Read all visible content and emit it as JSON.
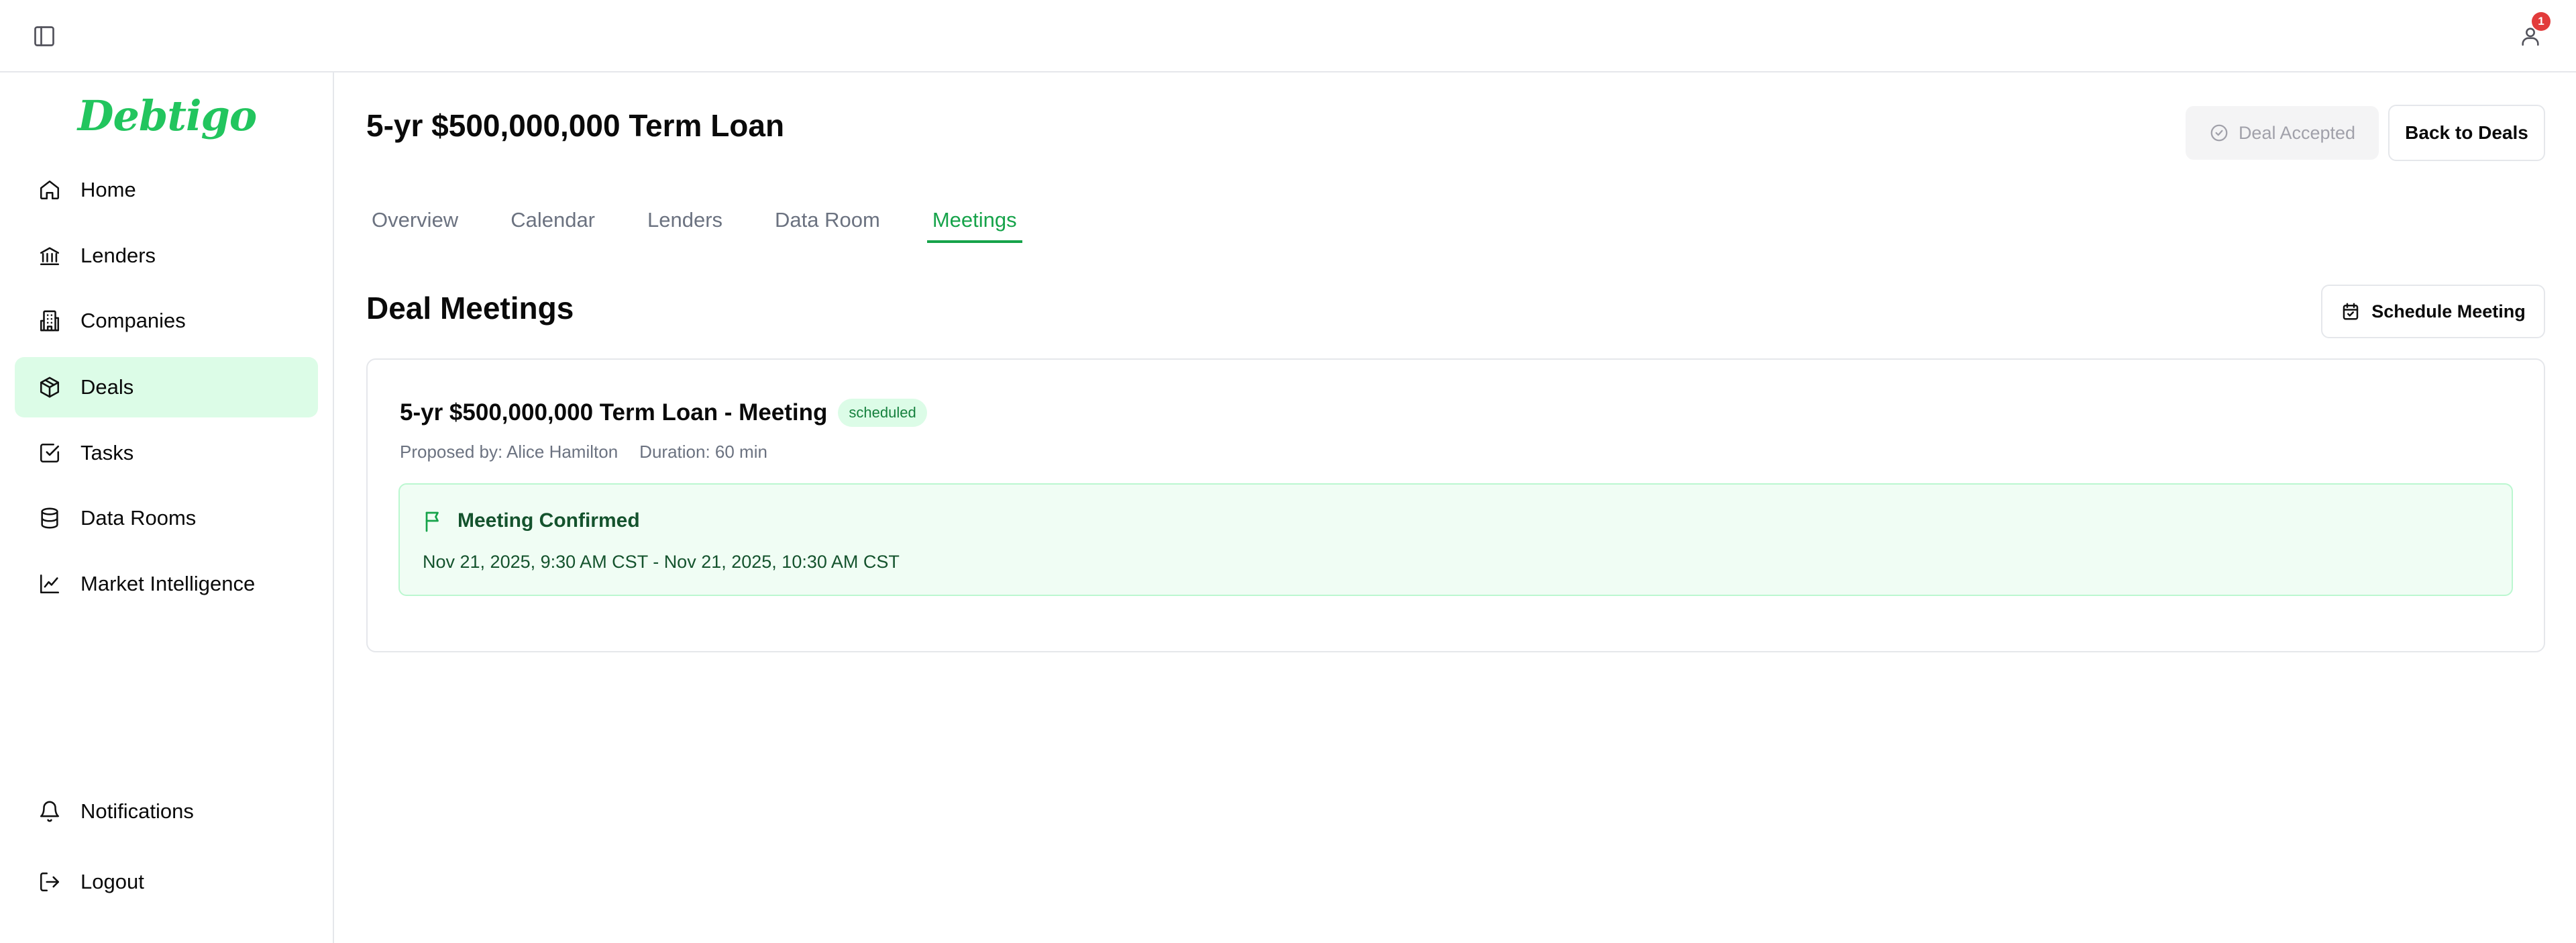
{
  "app": {
    "logo": "Debtigo",
    "notification_count": "1"
  },
  "sidebar": {
    "items": [
      {
        "label": "Home",
        "icon": "home-icon"
      },
      {
        "label": "Lenders",
        "icon": "bank-icon"
      },
      {
        "label": "Companies",
        "icon": "building-icon"
      },
      {
        "label": "Deals",
        "icon": "package-icon",
        "active": true
      },
      {
        "label": "Tasks",
        "icon": "checkbox-icon"
      },
      {
        "label": "Data Rooms",
        "icon": "database-icon"
      },
      {
        "label": "Market Intelligence",
        "icon": "chart-line-icon"
      }
    ],
    "bottom": [
      {
        "label": "Notifications",
        "icon": "bell-icon"
      },
      {
        "label": "Logout",
        "icon": "logout-icon"
      }
    ]
  },
  "header": {
    "title": "5-yr $500,000,000 Term Loan",
    "accepted_label": "Deal Accepted",
    "back_label": "Back to Deals"
  },
  "tabs": [
    "Overview",
    "Calendar",
    "Lenders",
    "Data Room",
    "Meetings"
  ],
  "active_tab": "Meetings",
  "meetings": {
    "section_title": "Deal Meetings",
    "schedule_label": "Schedule Meeting",
    "items": [
      {
        "title": "5-yr $500,000,000 Term Loan - Meeting",
        "status": "scheduled",
        "proposed_by": "Proposed by: Alice Hamilton",
        "duration": "Duration: 60 min",
        "confirmed_label": "Meeting Confirmed",
        "time_range": "Nov 21, 2025, 9:30 AM CST - Nov 21, 2025, 10:30 AM CST"
      }
    ]
  },
  "colors": {
    "accent": "#16a34a",
    "logo": "#22c55e",
    "active_bg": "#dcfce7",
    "badge": "#e23b3b"
  }
}
